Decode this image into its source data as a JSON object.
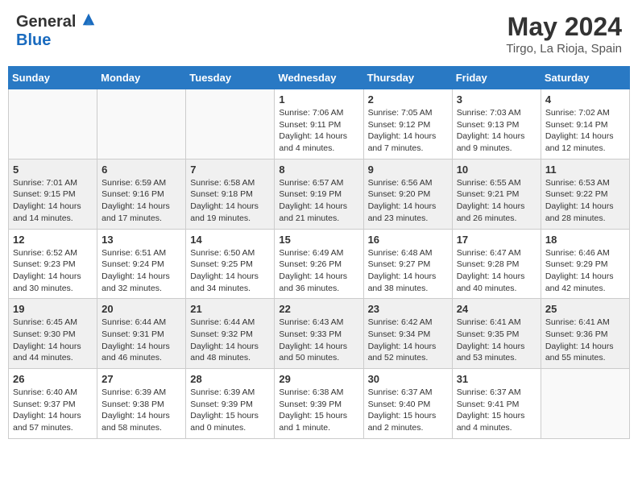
{
  "header": {
    "logo_general": "General",
    "logo_blue": "Blue",
    "title": "May 2024",
    "subtitle": "Tirgo, La Rioja, Spain"
  },
  "days_of_week": [
    "Sunday",
    "Monday",
    "Tuesday",
    "Wednesday",
    "Thursday",
    "Friday",
    "Saturday"
  ],
  "weeks": [
    [
      {
        "day": "",
        "sunrise": "",
        "sunset": "",
        "daylight": ""
      },
      {
        "day": "",
        "sunrise": "",
        "sunset": "",
        "daylight": ""
      },
      {
        "day": "",
        "sunrise": "",
        "sunset": "",
        "daylight": ""
      },
      {
        "day": "1",
        "sunrise": "Sunrise: 7:06 AM",
        "sunset": "Sunset: 9:11 PM",
        "daylight": "Daylight: 14 hours and 4 minutes."
      },
      {
        "day": "2",
        "sunrise": "Sunrise: 7:05 AM",
        "sunset": "Sunset: 9:12 PM",
        "daylight": "Daylight: 14 hours and 7 minutes."
      },
      {
        "day": "3",
        "sunrise": "Sunrise: 7:03 AM",
        "sunset": "Sunset: 9:13 PM",
        "daylight": "Daylight: 14 hours and 9 minutes."
      },
      {
        "day": "4",
        "sunrise": "Sunrise: 7:02 AM",
        "sunset": "Sunset: 9:14 PM",
        "daylight": "Daylight: 14 hours and 12 minutes."
      }
    ],
    [
      {
        "day": "5",
        "sunrise": "Sunrise: 7:01 AM",
        "sunset": "Sunset: 9:15 PM",
        "daylight": "Daylight: 14 hours and 14 minutes."
      },
      {
        "day": "6",
        "sunrise": "Sunrise: 6:59 AM",
        "sunset": "Sunset: 9:16 PM",
        "daylight": "Daylight: 14 hours and 17 minutes."
      },
      {
        "day": "7",
        "sunrise": "Sunrise: 6:58 AM",
        "sunset": "Sunset: 9:18 PM",
        "daylight": "Daylight: 14 hours and 19 minutes."
      },
      {
        "day": "8",
        "sunrise": "Sunrise: 6:57 AM",
        "sunset": "Sunset: 9:19 PM",
        "daylight": "Daylight: 14 hours and 21 minutes."
      },
      {
        "day": "9",
        "sunrise": "Sunrise: 6:56 AM",
        "sunset": "Sunset: 9:20 PM",
        "daylight": "Daylight: 14 hours and 23 minutes."
      },
      {
        "day": "10",
        "sunrise": "Sunrise: 6:55 AM",
        "sunset": "Sunset: 9:21 PM",
        "daylight": "Daylight: 14 hours and 26 minutes."
      },
      {
        "day": "11",
        "sunrise": "Sunrise: 6:53 AM",
        "sunset": "Sunset: 9:22 PM",
        "daylight": "Daylight: 14 hours and 28 minutes."
      }
    ],
    [
      {
        "day": "12",
        "sunrise": "Sunrise: 6:52 AM",
        "sunset": "Sunset: 9:23 PM",
        "daylight": "Daylight: 14 hours and 30 minutes."
      },
      {
        "day": "13",
        "sunrise": "Sunrise: 6:51 AM",
        "sunset": "Sunset: 9:24 PM",
        "daylight": "Daylight: 14 hours and 32 minutes."
      },
      {
        "day": "14",
        "sunrise": "Sunrise: 6:50 AM",
        "sunset": "Sunset: 9:25 PM",
        "daylight": "Daylight: 14 hours and 34 minutes."
      },
      {
        "day": "15",
        "sunrise": "Sunrise: 6:49 AM",
        "sunset": "Sunset: 9:26 PM",
        "daylight": "Daylight: 14 hours and 36 minutes."
      },
      {
        "day": "16",
        "sunrise": "Sunrise: 6:48 AM",
        "sunset": "Sunset: 9:27 PM",
        "daylight": "Daylight: 14 hours and 38 minutes."
      },
      {
        "day": "17",
        "sunrise": "Sunrise: 6:47 AM",
        "sunset": "Sunset: 9:28 PM",
        "daylight": "Daylight: 14 hours and 40 minutes."
      },
      {
        "day": "18",
        "sunrise": "Sunrise: 6:46 AM",
        "sunset": "Sunset: 9:29 PM",
        "daylight": "Daylight: 14 hours and 42 minutes."
      }
    ],
    [
      {
        "day": "19",
        "sunrise": "Sunrise: 6:45 AM",
        "sunset": "Sunset: 9:30 PM",
        "daylight": "Daylight: 14 hours and 44 minutes."
      },
      {
        "day": "20",
        "sunrise": "Sunrise: 6:44 AM",
        "sunset": "Sunset: 9:31 PM",
        "daylight": "Daylight: 14 hours and 46 minutes."
      },
      {
        "day": "21",
        "sunrise": "Sunrise: 6:44 AM",
        "sunset": "Sunset: 9:32 PM",
        "daylight": "Daylight: 14 hours and 48 minutes."
      },
      {
        "day": "22",
        "sunrise": "Sunrise: 6:43 AM",
        "sunset": "Sunset: 9:33 PM",
        "daylight": "Daylight: 14 hours and 50 minutes."
      },
      {
        "day": "23",
        "sunrise": "Sunrise: 6:42 AM",
        "sunset": "Sunset: 9:34 PM",
        "daylight": "Daylight: 14 hours and 52 minutes."
      },
      {
        "day": "24",
        "sunrise": "Sunrise: 6:41 AM",
        "sunset": "Sunset: 9:35 PM",
        "daylight": "Daylight: 14 hours and 53 minutes."
      },
      {
        "day": "25",
        "sunrise": "Sunrise: 6:41 AM",
        "sunset": "Sunset: 9:36 PM",
        "daylight": "Daylight: 14 hours and 55 minutes."
      }
    ],
    [
      {
        "day": "26",
        "sunrise": "Sunrise: 6:40 AM",
        "sunset": "Sunset: 9:37 PM",
        "daylight": "Daylight: 14 hours and 57 minutes."
      },
      {
        "day": "27",
        "sunrise": "Sunrise: 6:39 AM",
        "sunset": "Sunset: 9:38 PM",
        "daylight": "Daylight: 14 hours and 58 minutes."
      },
      {
        "day": "28",
        "sunrise": "Sunrise: 6:39 AM",
        "sunset": "Sunset: 9:39 PM",
        "daylight": "Daylight: 15 hours and 0 minutes."
      },
      {
        "day": "29",
        "sunrise": "Sunrise: 6:38 AM",
        "sunset": "Sunset: 9:39 PM",
        "daylight": "Daylight: 15 hours and 1 minute."
      },
      {
        "day": "30",
        "sunrise": "Sunrise: 6:37 AM",
        "sunset": "Sunset: 9:40 PM",
        "daylight": "Daylight: 15 hours and 2 minutes."
      },
      {
        "day": "31",
        "sunrise": "Sunrise: 6:37 AM",
        "sunset": "Sunset: 9:41 PM",
        "daylight": "Daylight: 15 hours and 4 minutes."
      },
      {
        "day": "",
        "sunrise": "",
        "sunset": "",
        "daylight": ""
      }
    ]
  ]
}
